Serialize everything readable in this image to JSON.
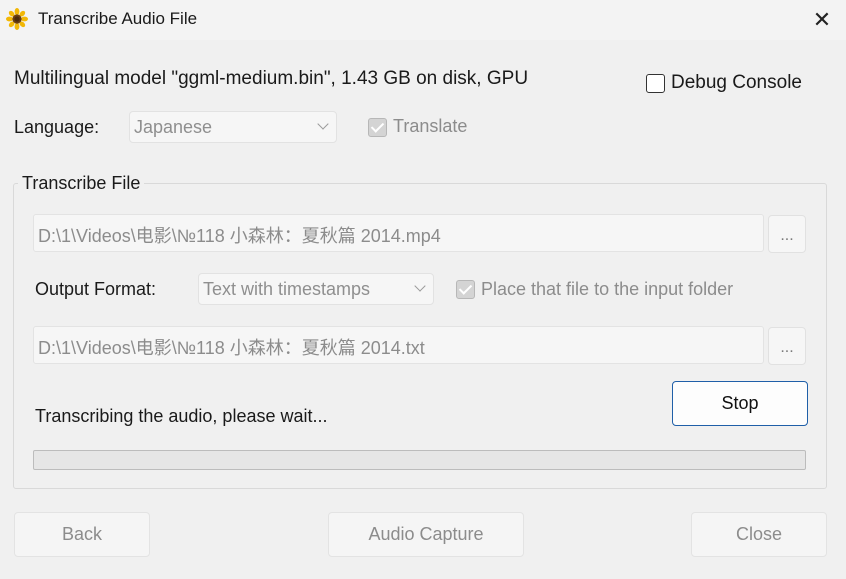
{
  "window": {
    "title": "Transcribe Audio File",
    "icon": "sunflower-icon",
    "close_glyph": "✕"
  },
  "model": {
    "info": "Multilingual model \"ggml-medium.bin\", 1.43 GB on disk, GPU"
  },
  "debug_console": {
    "label": "Debug Console",
    "checked": false
  },
  "language": {
    "label": "Language:",
    "selected": "Japanese",
    "enabled": false
  },
  "translate": {
    "label": "Translate",
    "checked": true,
    "enabled": false
  },
  "transcribe_group": {
    "title": "Transcribe File",
    "input_path": "D:\\1\\Videos\\电影\\№118 小森林：夏秋篇 2014.mp4",
    "browse_label": "...",
    "output_format_label": "Output Format:",
    "output_format": "Text with timestamps",
    "place_label": "Place that file to the input folder",
    "place_checked": true,
    "output_path": "D:\\1\\Videos\\电影\\№118 小森林：夏秋篇 2014.txt",
    "stop_label": "Stop",
    "status": "Transcribing the audio, please wait...",
    "progress": 0
  },
  "buttons": {
    "back": "Back",
    "audio_capture": "Audio Capture",
    "close": "Close"
  },
  "colors": {
    "accent": "#1f5fa8",
    "disabled_text": "#8c8c8c",
    "background": "#f0f0f0"
  }
}
